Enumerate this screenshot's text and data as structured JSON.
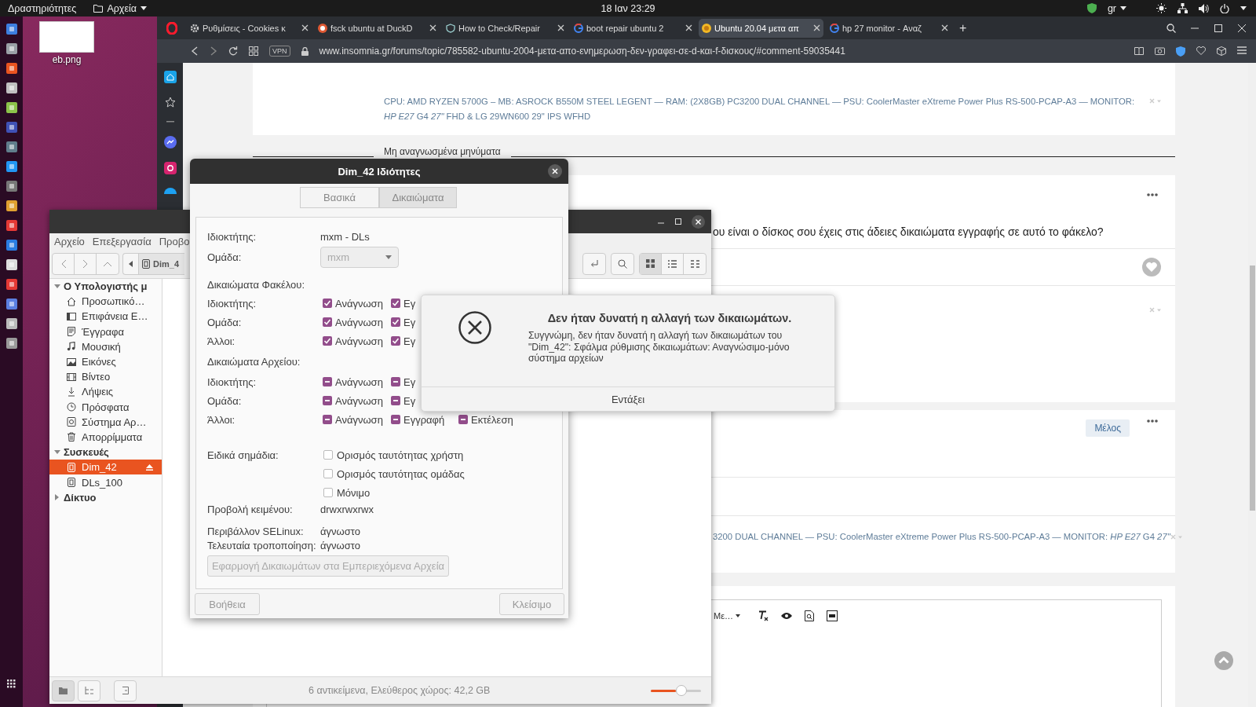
{
  "top_bar": {
    "activities": "Δραστηριότητες",
    "app_menu": "Αρχεία",
    "clock": "18 Ιαν  23:29",
    "keyboard_layout": "gr"
  },
  "desktop_icons": [
    {
      "label": "eb.png"
    }
  ],
  "browser": {
    "tabs": [
      {
        "title": "Ρυθμίσεις - Cookies κ",
        "kind": "settings",
        "selected": false
      },
      {
        "title": "fsck ubuntu at DuckD",
        "kind": "duck",
        "selected": false
      },
      {
        "title": "How to Check/Repair",
        "kind": "shield",
        "selected": false
      },
      {
        "title": "boot repair ubuntu 2",
        "kind": "google",
        "selected": false
      },
      {
        "title": "Ubuntu 20.04 μετα απ",
        "kind": "forum",
        "selected": true
      },
      {
        "title": "hp 27 monitor - Αναζ",
        "kind": "google",
        "selected": false
      }
    ],
    "new_tab": "+",
    "vpn": "VPN",
    "url": "www.insomnia.gr/forums/topic/785582-ubuntu-2004-μετα-απο-ενημερωση-δεν-γραφει-σε-d-και-f-δισκους/#comment-59035441",
    "page": {
      "signature_1": "CPU: AMD RYZEN 5700G – MB: ASROCK B550M  STEEL LEGENT — RAM:  (2X8GB) PC3200 DUAL CHANNEL — PSU: CoolerMaster eXtreme Power Plus RS-500-PCAP-A3 — MONITOR: *HP E27* G4   *27\"* FHD   &   LG 29WN600 29\" IPS WFHD",
      "unread_divider": "Μη αναγνωσμένα μηνύματα",
      "post_text": "ου είναι ο δίσκος σου έχεις στις άδειες δικαιώματα εγγραφής σε αυτό το φάκελο?",
      "member_badge": "Μέλος",
      "signature_2": "3200 DUAL CHANNEL — PSU: CoolerMaster eXtreme Power Plus RS-500-PCAP-A3 — MONITOR: *HP E27* G4   *27\"*",
      "editor_font_menu": "Με…"
    }
  },
  "file_manager": {
    "menu": [
      "Αρχείο",
      "Επεξεργασία",
      "Προβο"
    ],
    "path_button": "Dim_4",
    "sidebar": [
      {
        "label": "Ο Υπολογιστής μ",
        "expanded": true,
        "children": [
          {
            "label": "Προσωπικό…",
            "kind": "home",
            "selected": false
          },
          {
            "label": "Επιφάνεια Ε…",
            "kind": "desktop",
            "selected": false
          },
          {
            "label": "Έγγραφα",
            "kind": "documents",
            "selected": false
          },
          {
            "label": "Μουσική",
            "kind": "music",
            "selected": false
          },
          {
            "label": "Εικόνες",
            "kind": "pictures",
            "selected": false
          },
          {
            "label": "Βίντεο",
            "kind": "videos",
            "selected": false
          },
          {
            "label": "Λήψεις",
            "kind": "downloads",
            "selected": false
          },
          {
            "label": "Πρόσφατα",
            "kind": "recent",
            "selected": false
          },
          {
            "label": "Σύστημα Αρ…",
            "kind": "filesystem",
            "selected": false
          },
          {
            "label": "Απορρίμματα",
            "kind": "trash",
            "selected": false
          }
        ]
      },
      {
        "label": "Συσκευές",
        "expanded": true,
        "children": [
          {
            "label": "Dim_42",
            "kind": "drive",
            "selected": true
          },
          {
            "label": "DLs_100",
            "kind": "drive",
            "selected": false
          }
        ]
      },
      {
        "label": "Δίκτυο",
        "expanded": false
      }
    ],
    "status": "6 αντικείμενα, Ελεύθερος χώρος: 42,2 GB",
    "zoom": {
      "level": 0.5
    }
  },
  "properties_dialog": {
    "title": "Dim_42 Ιδιότητες",
    "tabs": [
      {
        "label": "Βασικά",
        "selected": false
      },
      {
        "label": "Δικαιώματα",
        "selected": true
      }
    ],
    "owner": {
      "label": "Ιδιοκτήτης:",
      "value": "mxm - DLs"
    },
    "group": {
      "label": "Ομάδα:",
      "value": "mxm"
    },
    "sections": [
      {
        "heading": "Δικαιώματα Φακέλου:",
        "rows": [
          {
            "label": "Ιδιοκτήτης:",
            "boxes": [
              {
                "label": "Ανάγνωση",
                "checked": true
              },
              {
                "label": "Εγ",
                "checked": true
              }
            ]
          },
          {
            "label": "Ομάδα:",
            "boxes": [
              {
                "label": "Ανάγνωση",
                "checked": true
              },
              {
                "label": "Εγ",
                "checked": true
              }
            ]
          },
          {
            "label": "Άλλοι:",
            "boxes": [
              {
                "label": "Ανάγνωση",
                "checked": true
              },
              {
                "label": "Εγ",
                "checked": true
              }
            ]
          }
        ]
      },
      {
        "heading": "Δικαιώματα Αρχείου:",
        "rows": [
          {
            "label": "Ιδιοκτήτης:",
            "boxes": [
              {
                "label": "Ανάγνωση",
                "inconsistent": true
              },
              {
                "label": "Εγ",
                "inconsistent": true
              }
            ]
          },
          {
            "label": "Ομάδα:",
            "boxes": [
              {
                "label": "Ανάγνωση",
                "inconsistent": true
              },
              {
                "label": "Εγ",
                "inconsistent": true
              }
            ]
          },
          {
            "label": "Άλλοι:",
            "boxes": [
              {
                "label": "Ανάγνωση",
                "inconsistent": true
              },
              {
                "label": "Εγγραφή",
                "inconsistent": true
              },
              {
                "label": "Εκτέλεση",
                "inconsistent": true
              }
            ]
          }
        ]
      }
    ],
    "special": {
      "label": "Ειδικά σημάδια:",
      "flags": [
        {
          "label": "Ορισμός ταυτότητας χρήστη",
          "checked": false
        },
        {
          "label": "Ορισμός ταυτότητας ομάδας",
          "checked": false
        },
        {
          "label": "Μόνιμο",
          "checked": false
        }
      ]
    },
    "text_view": {
      "label": "Προβολή κειμένου:",
      "value": "drwxrwxrwx"
    },
    "selinux": {
      "label": "Περιβάλλον SELinux:",
      "value": "άγνωστο"
    },
    "modified": {
      "label": "Τελευταία τροποποίηση:",
      "value": "άγνωστο"
    },
    "apply_button": "Εφαρμογή Δικαιωμάτων στα Εμπεριεχόμενα Αρχεία",
    "help_button": "Βοήθεια",
    "close_button": "Κλείσιμο"
  },
  "error_dialog": {
    "title": "Δεν ήταν δυνατή η αλλαγή των δικαιωμάτων.",
    "message": "Συγγνώμη, δεν ήταν δυνατή η αλλαγή των δικαιωμάτων του \"Dim_42\": Σφάλμα ρύθμισης δικαιωμάτων: Αναγνώσιμο-μόνο σύστημα αρχείων",
    "ok_button": "Εντάξει"
  }
}
